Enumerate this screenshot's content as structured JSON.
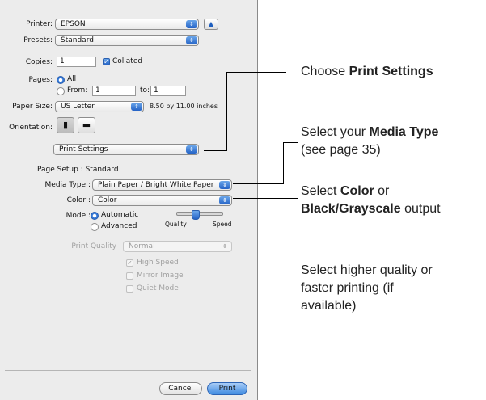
{
  "printer": {
    "label": "Printer:",
    "value": "EPSON"
  },
  "presets": {
    "label": "Presets:",
    "value": "Standard"
  },
  "copies": {
    "label": "Copies:",
    "value": "1",
    "collated_label": "Collated",
    "collated": true
  },
  "pages": {
    "label": "Pages:",
    "all_label": "All",
    "from_label": "From:",
    "from_value": "1",
    "to_label": "to:",
    "to_value": "1",
    "selected": "All"
  },
  "paper_size": {
    "label": "Paper Size:",
    "value": "US Letter",
    "dimensions": "8.50 by 11.00 inches"
  },
  "orientation": {
    "label": "Orientation:"
  },
  "panel": {
    "value": "Print Settings"
  },
  "page_setup": {
    "text": "Page Setup : Standard"
  },
  "media_type": {
    "label": "Media Type :",
    "value": "Plain Paper / Bright White Paper"
  },
  "color": {
    "label": "Color :",
    "value": "Color"
  },
  "mode": {
    "label": "Mode :",
    "automatic_label": "Automatic",
    "advanced_label": "Advanced",
    "selected": "Automatic",
    "quality_label": "Quality",
    "speed_label": "Speed"
  },
  "print_quality": {
    "label": "Print Quality :",
    "value": "Normal"
  },
  "options": {
    "high_speed": "High Speed",
    "mirror_image": "Mirror Image",
    "quiet_mode": "Quiet Mode"
  },
  "buttons": {
    "cancel": "Cancel",
    "print": "Print"
  },
  "callouts": {
    "c1_prefix": "Choose ",
    "c1_bold": "Print Settings",
    "c2_prefix": "Select your ",
    "c2_bold": "Media Type",
    "c2_line2": "(see page 35)",
    "c3_prefix": "Select ",
    "c3_bold1": "Color",
    "c3_mid": " or",
    "c3_bold2": "Black/Grayscale",
    "c3_suffix": " output",
    "c4_line1": "Select higher quality or",
    "c4_line2": "faster printing (if",
    "c4_line3": "available)"
  },
  "colors": {
    "accent": "#3478d6",
    "dialog_bg": "#ececec"
  }
}
